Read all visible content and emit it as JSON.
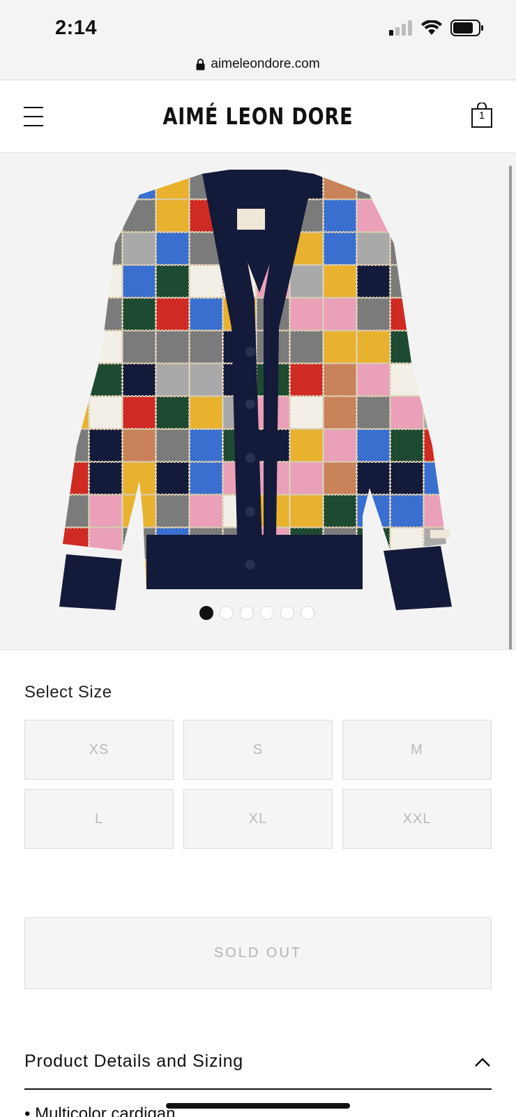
{
  "status_bar": {
    "time": "2:14"
  },
  "browser": {
    "url": "aimeleondore.com"
  },
  "header": {
    "brand": "AIMÉ LEON DORE",
    "cart_count": "1"
  },
  "gallery": {
    "image_count": 6,
    "active_index": 0,
    "product_icon": "patchwork-cardigan-image"
  },
  "size": {
    "label": "Select Size",
    "options": [
      "XS",
      "S",
      "M",
      "L",
      "XL",
      "XXL"
    ]
  },
  "sold_out_label": "SOLD OUT",
  "details": {
    "title": "Product Details and Sizing",
    "first_bullet": "• Multicolor cardigan"
  },
  "colors": {
    "navy": "#141a3a",
    "disabled_text": "#b9b9b9"
  }
}
